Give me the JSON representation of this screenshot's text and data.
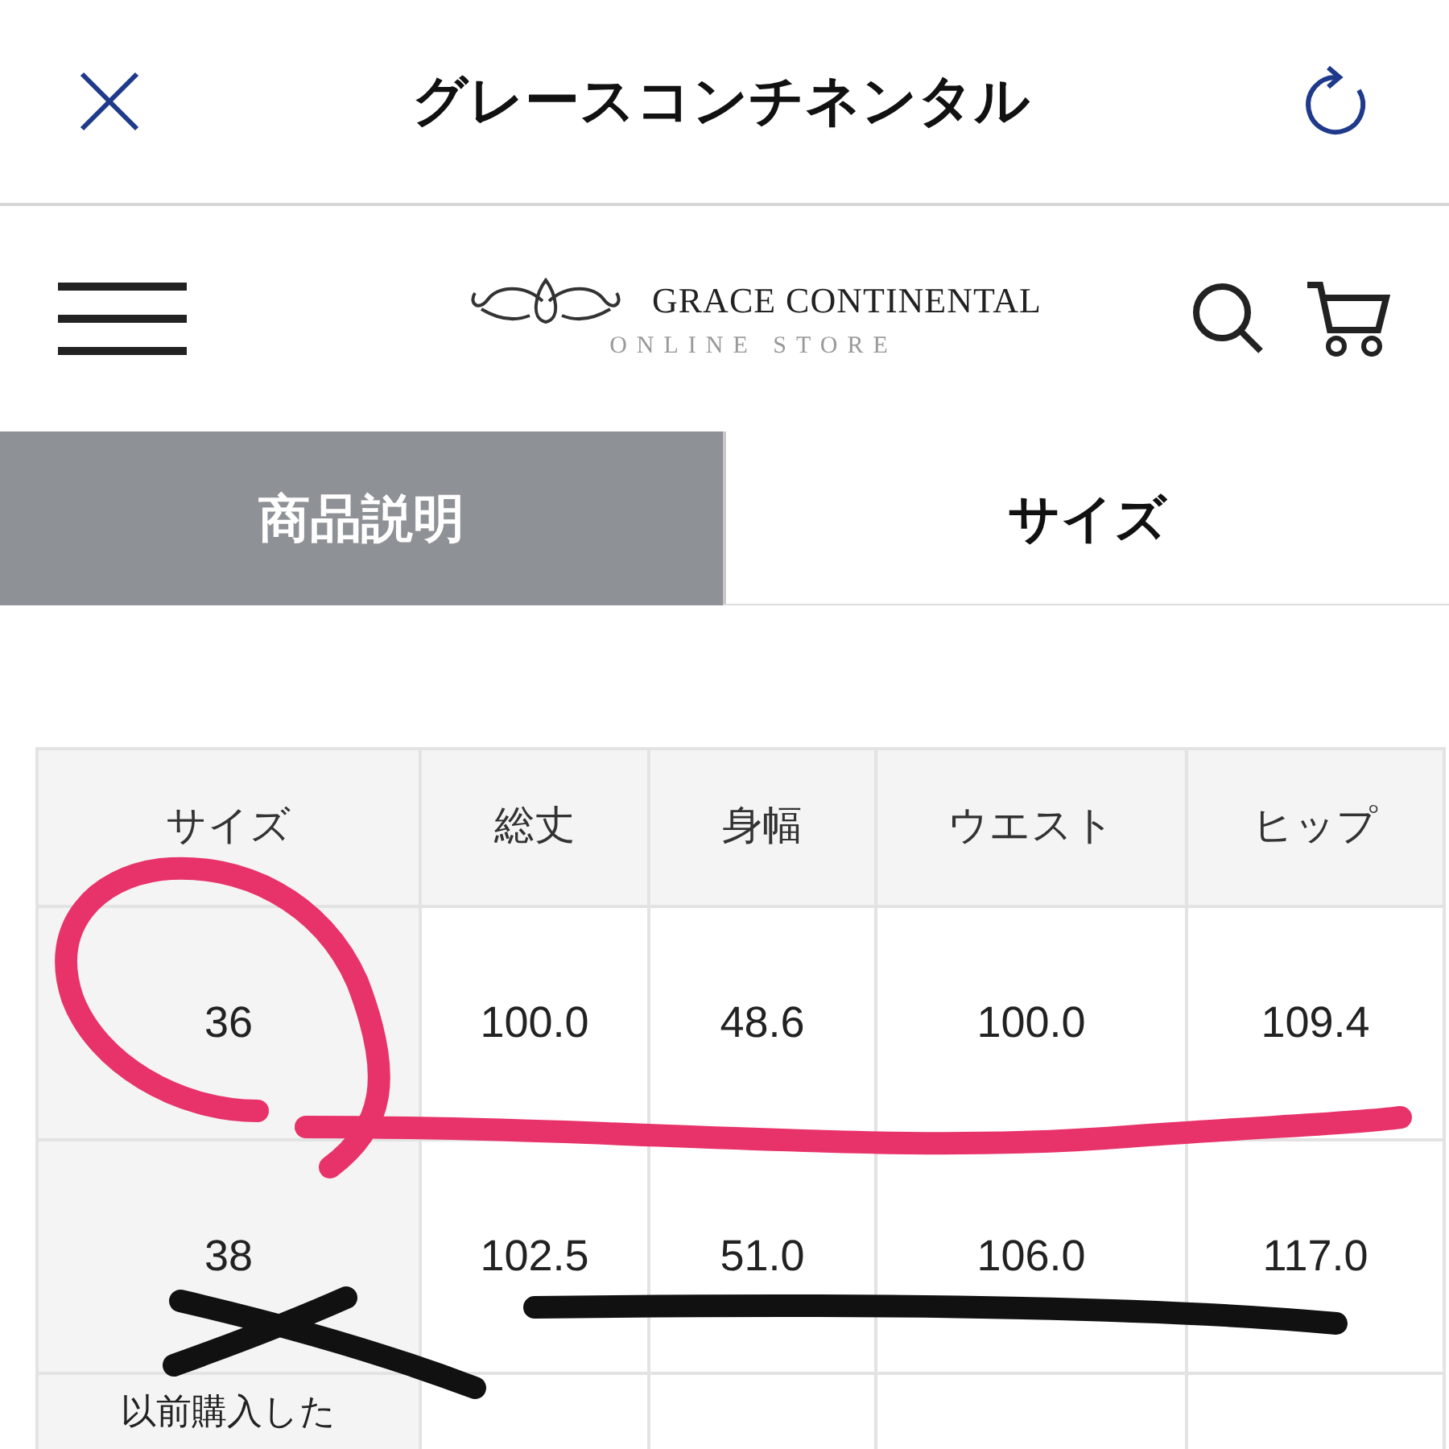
{
  "top_bar": {
    "title": "グレースコンチネンタル"
  },
  "header": {
    "brand": "GRACE CONTINENTAL",
    "subtitle": "ONLINE STORE"
  },
  "tabs": [
    {
      "label": "商品説明",
      "selected": false
    },
    {
      "label": "サイズ",
      "selected": true
    }
  ],
  "size_table": {
    "columns": [
      "サイズ",
      "総丈",
      "身幅",
      "ウエスト",
      "ヒップ"
    ],
    "rows": [
      {
        "cells": [
          "36",
          "100.0",
          "48.6",
          "100.0",
          "109.4"
        ]
      },
      {
        "cells": [
          "38",
          "102.5",
          "51.0",
          "106.0",
          "117.0"
        ]
      },
      {
        "cells": [
          "以前購入した"
        ]
      }
    ]
  }
}
